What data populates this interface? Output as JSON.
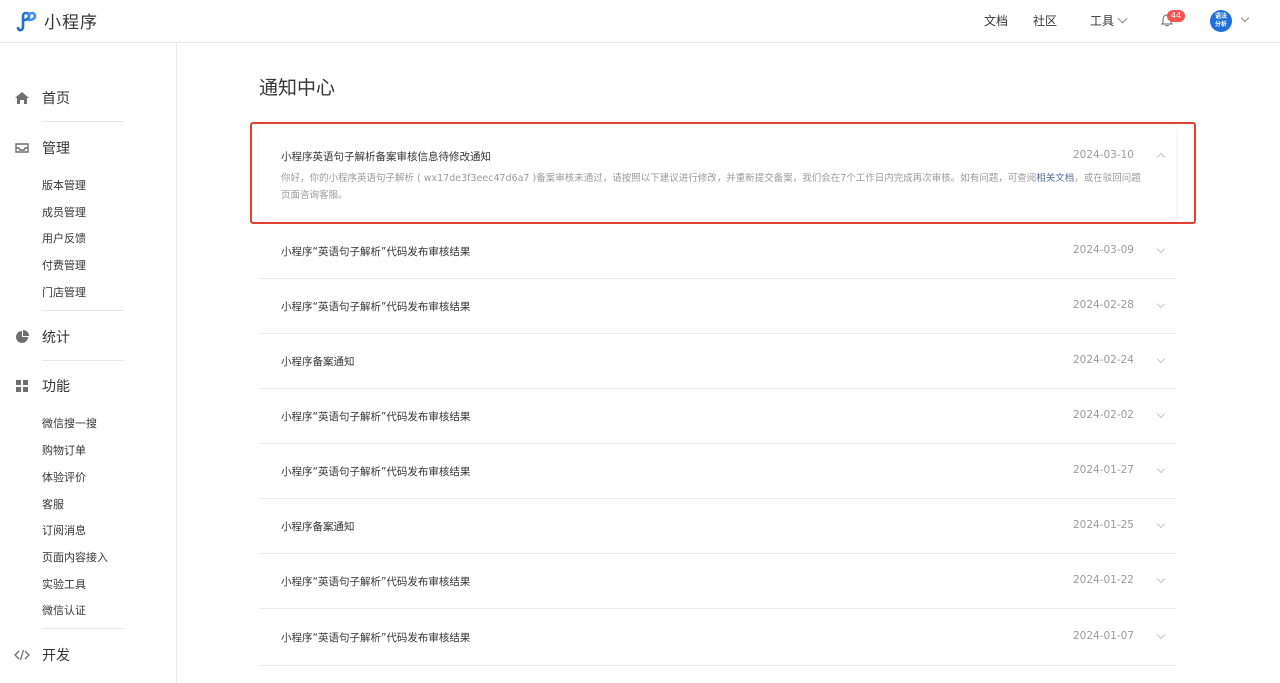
{
  "header": {
    "app_name": "小程序",
    "nav": {
      "docs": "文档",
      "community": "社区",
      "tools": "工具"
    },
    "notification_count": "44",
    "avatar_text": "语法分析"
  },
  "sidebar": {
    "home": "首页",
    "manage": {
      "label": "管理",
      "items": [
        "版本管理",
        "成员管理",
        "用户反馈",
        "付费管理",
        "门店管理"
      ]
    },
    "stats": "统计",
    "features": {
      "label": "功能",
      "items": [
        "微信搜一搜",
        "购物订单",
        "体验评价",
        "客服",
        "订阅消息",
        "页面内容接入",
        "实验工具",
        "微信认证"
      ]
    },
    "develop": "开发"
  },
  "main": {
    "title": "通知中心",
    "expanded": {
      "title": "小程序英语句子解析备案审核信息待修改通知",
      "date": "2024-03-10",
      "body_text": "你好，你的小程序英语句子解析 ( wx17de3f3eec47d6a7 )备案审核未通过，请按照以下建议进行修改，并重新提交备案，我们会在7个工作日内完成再次审核。如有问题，可查阅",
      "body_link": "相关文档",
      "body_tail": "，或在驳回问题页面咨询客服。"
    },
    "notices": [
      {
        "title": "小程序“英语句子解析”代码发布审核结果",
        "date": "2024-03-09"
      },
      {
        "title": "小程序“英语句子解析”代码发布审核结果",
        "date": "2024-02-28"
      },
      {
        "title": "小程序备案通知",
        "date": "2024-02-24"
      },
      {
        "title": "小程序“英语句子解析”代码发布审核结果",
        "date": "2024-02-02"
      },
      {
        "title": "小程序“英语句子解析”代码发布审核结果",
        "date": "2024-01-27"
      },
      {
        "title": "小程序备案通知",
        "date": "2024-01-25"
      },
      {
        "title": "小程序“英语句子解析”代码发布审核结果",
        "date": "2024-01-22"
      },
      {
        "title": "小程序“英语句子解析”代码发布审核结果",
        "date": "2024-01-07"
      }
    ]
  },
  "colors": {
    "accent": "#576b95",
    "highlight_border": "#e0402f",
    "badge": "#fa5151"
  }
}
